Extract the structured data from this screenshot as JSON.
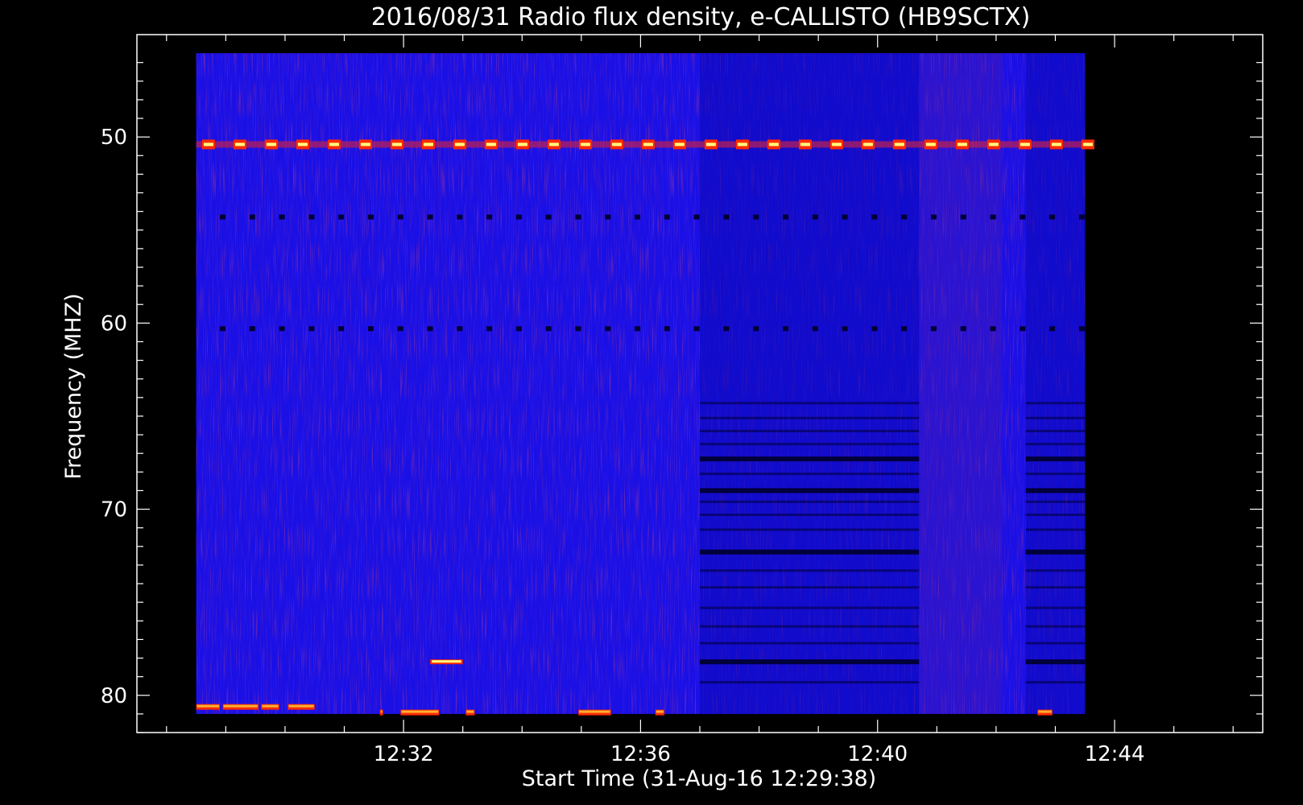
{
  "chart_data": {
    "type": "heatmap",
    "title": "2016/08/31  Radio flux density, e-CALLISTO (HB9SCTX)",
    "xlabel": "Start Time (31-Aug-16 12:29:38)",
    "ylabel": "Frequency (MHZ)",
    "x_tick_labels": [
      "12:32",
      "12:36",
      "12:40",
      "12:44"
    ],
    "y_tick_labels": [
      "50",
      "60",
      "70",
      "80"
    ],
    "x_ticks_min": [
      12.5,
      16.5,
      20.5,
      24.5
    ],
    "y_ticks": [
      50,
      60,
      70,
      80
    ],
    "xlim_min": [
      8.0,
      27.0
    ],
    "data_xlim_min": [
      9.0,
      24.0
    ],
    "ylim_mhz": [
      82,
      44.5
    ],
    "data_ylim_mhz": [
      81,
      45.5
    ],
    "colors": {
      "background": "#000000",
      "axes": "#ffffff",
      "base": "#1a10e6",
      "red_noise": "#a01030",
      "dark_band": "#000033",
      "hot": "#ff2a00",
      "hotter": "#ffb030",
      "peak": "#ffff80"
    },
    "features": {
      "strong_band_mhz": 50.4,
      "strong_band_x_min": [
        9.0,
        24.0
      ],
      "dotted_bands_mhz": [
        54.3,
        60.3
      ],
      "dark_region_x_min": [
        17.5,
        21.2
      ],
      "dark_region2_x_min": [
        23.0,
        24.0
      ],
      "bright_column_x_min": [
        21.2,
        22.6
      ],
      "dark_lines_mhz": [
        64.3,
        65.1,
        65.8,
        66.5,
        67.3,
        68.1,
        69.0,
        69.6,
        70.3,
        71.1,
        72.3,
        73.3,
        74.2,
        75.3,
        76.3,
        77.2,
        78.2,
        79.3
      ],
      "thick_dark_lines_mhz": [
        67.3,
        69.0,
        72.3,
        78.2
      ],
      "burst_bottom_segments": [
        {
          "x": [
            9.0,
            9.4
          ],
          "mhz": 80.6
        },
        {
          "x": [
            9.45,
            10.05
          ],
          "mhz": 80.6
        },
        {
          "x": [
            10.1,
            10.4
          ],
          "mhz": 80.6
        },
        {
          "x": [
            10.55,
            11.0
          ],
          "mhz": 80.6
        },
        {
          "x": [
            12.1,
            12.15
          ],
          "mhz": 80.9
        },
        {
          "x": [
            12.45,
            13.1
          ],
          "mhz": 80.9
        },
        {
          "x": [
            13.55,
            13.7
          ],
          "mhz": 80.9
        },
        {
          "x": [
            15.45,
            16.0
          ],
          "mhz": 80.9
        },
        {
          "x": [
            16.75,
            16.9
          ],
          "mhz": 80.9
        },
        {
          "x": [
            23.2,
            23.45
          ],
          "mhz": 80.9
        }
      ],
      "burst_mid_segment": {
        "x": [
          12.95,
          13.5
        ],
        "mhz": 78.2
      }
    }
  }
}
